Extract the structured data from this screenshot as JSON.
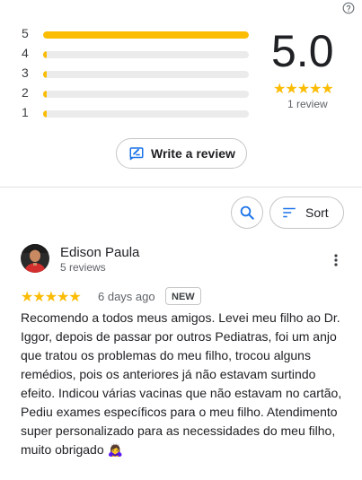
{
  "help": {
    "icon": "help-icon"
  },
  "rating_summary": {
    "distribution": [
      {
        "stars": "5",
        "fraction": 1.0
      },
      {
        "stars": "4",
        "fraction": 0.0
      },
      {
        "stars": "3",
        "fraction": 0.0
      },
      {
        "stars": "2",
        "fraction": 0.0
      },
      {
        "stars": "1",
        "fraction": 0.0
      }
    ],
    "average": "5.0",
    "stars": "★★★★★",
    "count": "1 review",
    "bar_color": "#fbbc04"
  },
  "actions": {
    "write_review": "Write a review",
    "write_icon": "edit-review-icon",
    "search_icon": "search-icon",
    "sort_label": "Sort",
    "sort_icon": "sort-icon"
  },
  "review": {
    "author": "Edison Paula",
    "author_meta": "5 reviews",
    "stars": "★★★★★",
    "rating": 5,
    "date": "6 days ago",
    "badge": "NEW",
    "text": "Recomendo a todos meus amigos. Levei meu filho ao Dr. Iggor, depois de passar por outros Pediatras, foi um anjo que tratou os problemas do meu filho, trocou alguns remédios, pois os anteriores já não estavam surtindo efeito. Indicou várias vacinas que não estavam no cartão, Pediu exames específicos para o meu filho. Atendimento super personalizado para as necessidades do meu filho, muito obrigado 🙇‍♀️",
    "more_icon": "more-vert-icon"
  }
}
